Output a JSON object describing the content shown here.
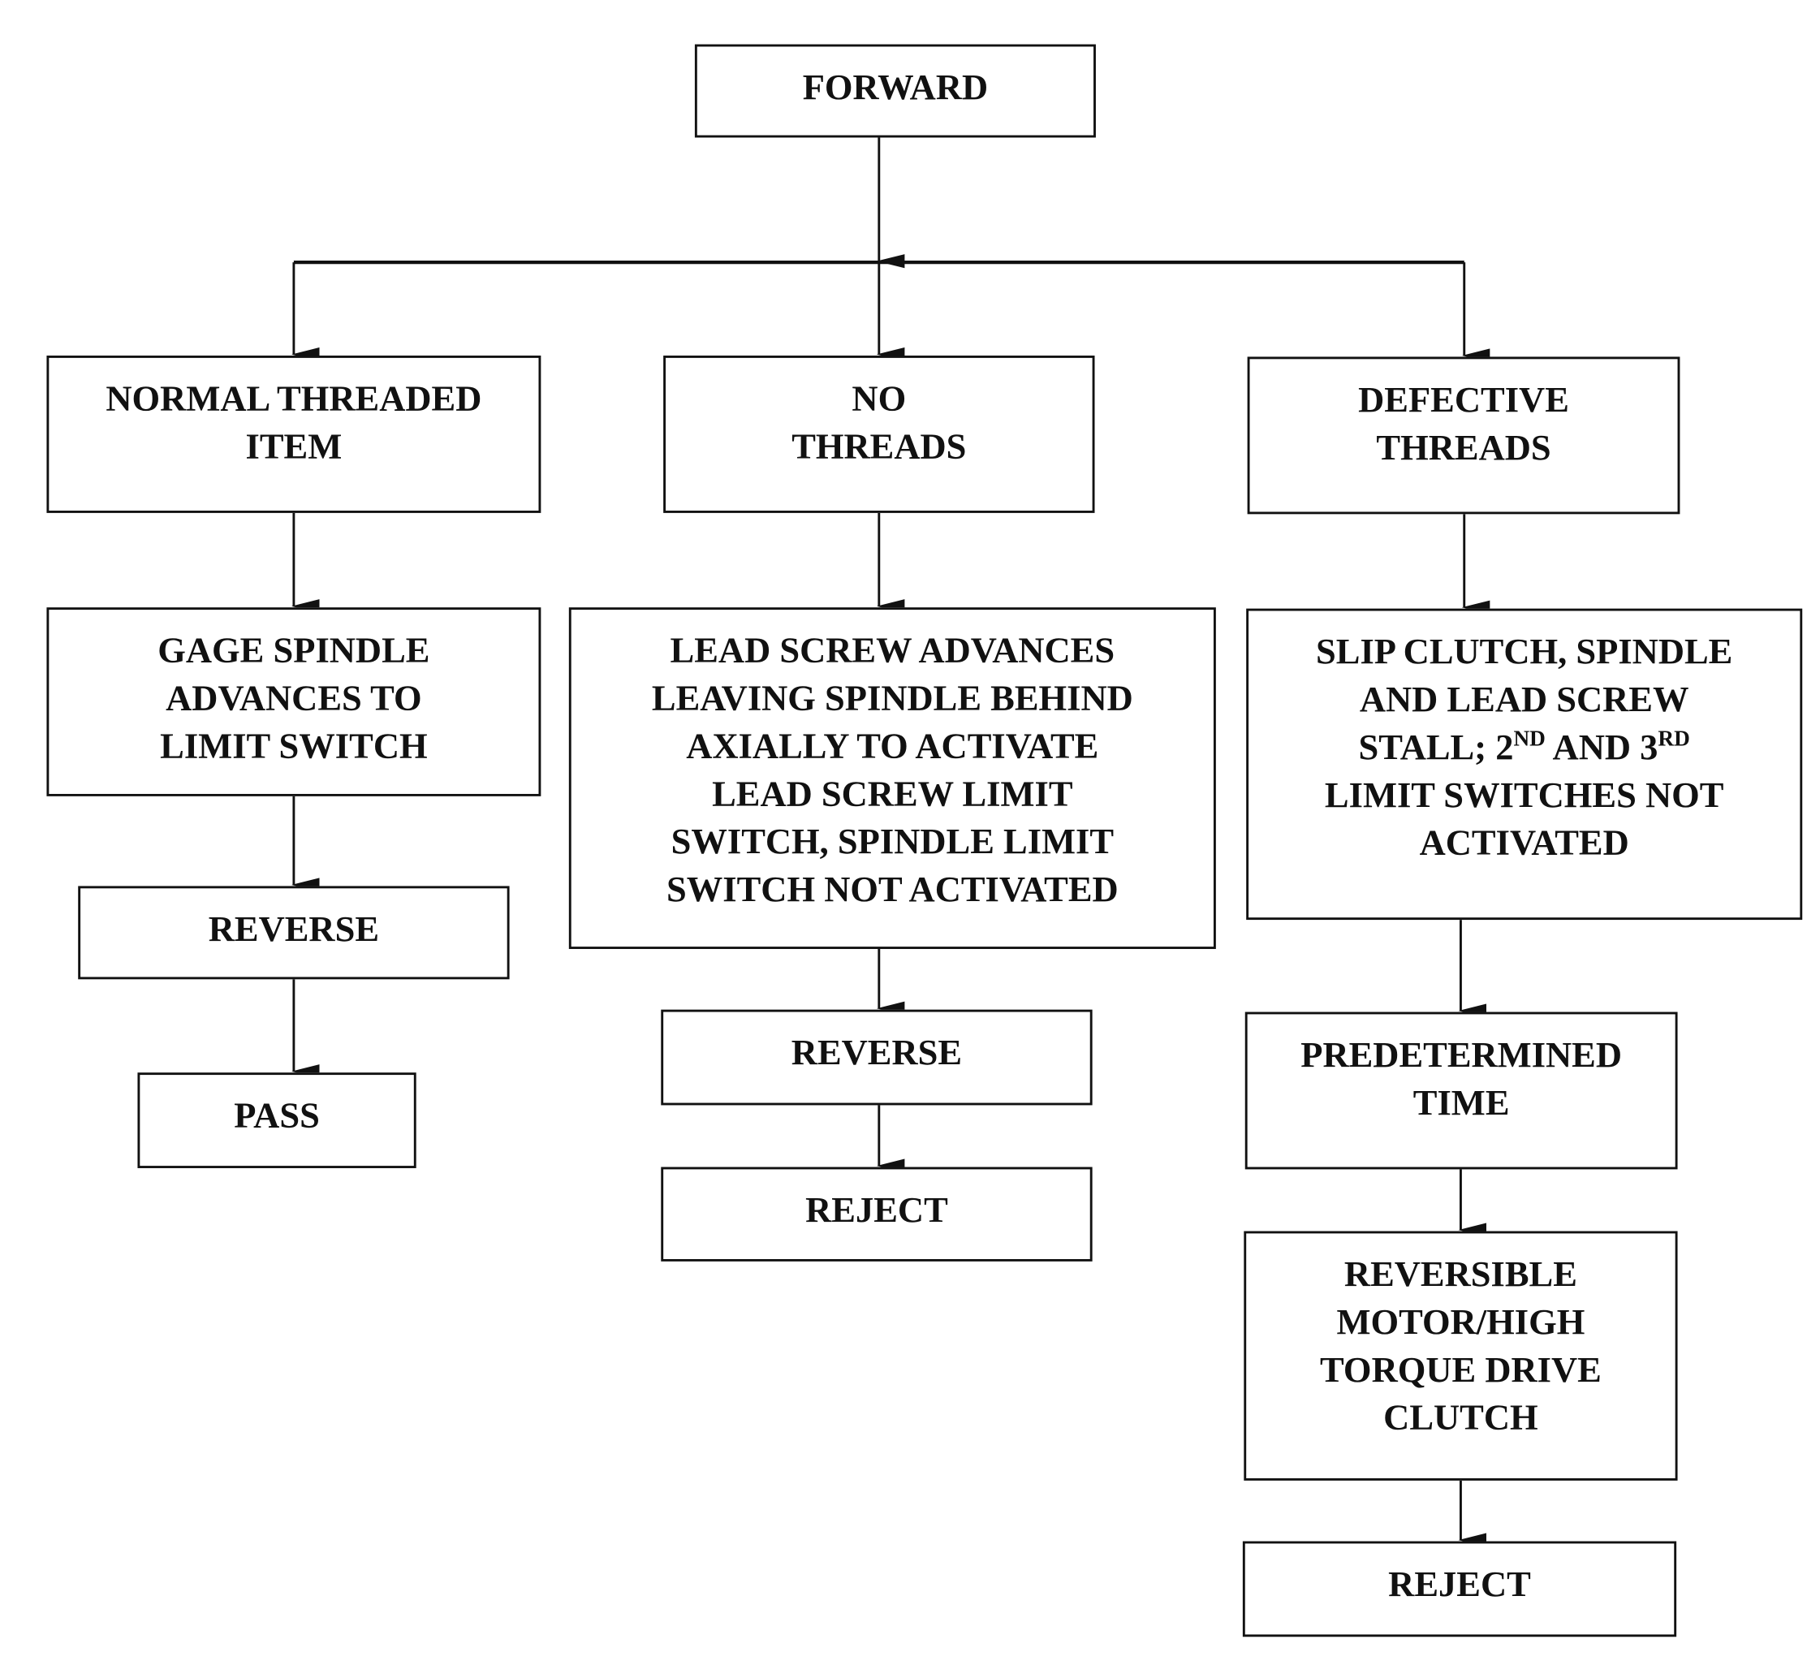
{
  "nodes": {
    "forward": "FORWARD",
    "normal": "NORMAL THREADED\nITEM",
    "no_threads": "NO\nTHREADS",
    "defective": "DEFECTIVE\nTHREADS",
    "gage": "GAGE SPINDLE\nADVANCES TO\nLIMIT SWITCH",
    "lead_screw": "LEAD SCREW ADVANCES\nLEAVING SPINDLE BEHIND\nAXIALLY TO ACTIVATE\nLEAD SCREW LIMIT\nSWITCH, SPINDLE LIMIT\nSWITCH NOT ACTIVATED",
    "slip_line1": "SLIP CLUTCH, SPINDLE\nAND LEAD SCREW\nSTALL; 2",
    "slip_sup1": "ND",
    "slip_mid": " AND 3",
    "slip_sup2": "RD",
    "slip_line2": "\nLIMIT SWITCHES NOT\nACTIVATED",
    "reverse_left": "REVERSE",
    "pass": "PASS",
    "reverse_mid": "REVERSE",
    "reject_mid": "REJECT",
    "predetermined": "PREDETERMINED\nTIME",
    "reversible": "REVERSIBLE\nMOTOR/HIGH\nTORQUE DRIVE\nCLUTCH",
    "reject_right": "REJECT"
  }
}
